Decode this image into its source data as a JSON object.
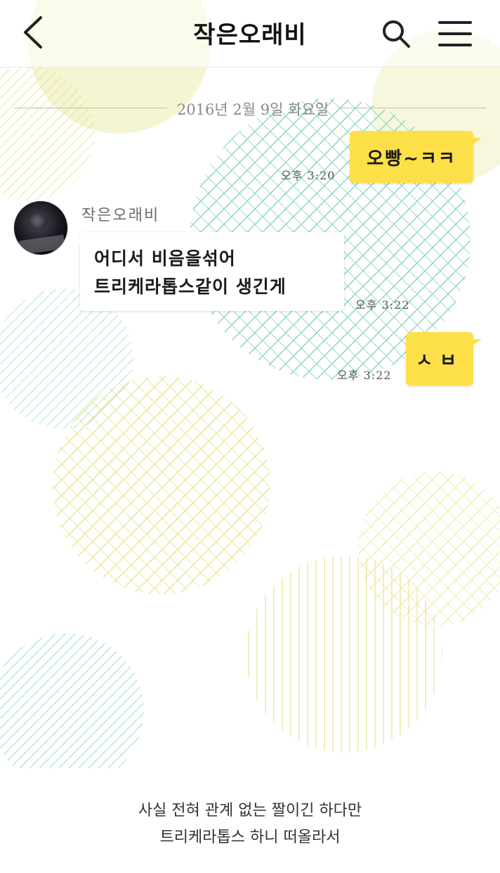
{
  "header": {
    "title": "작은오래비",
    "back_icon": "chevron-left-icon",
    "search_icon": "search-icon",
    "menu_icon": "hamburger-menu-icon"
  },
  "chat": {
    "date_divider": "2016년 2월 9일 화요일",
    "messages": [
      {
        "from": "me",
        "text": "오빵~ㅋㅋ",
        "time": "오후 3:20"
      },
      {
        "from": "them",
        "sender": "작은오래비",
        "lines": [
          "어디서 비음을섞어",
          "트리케라톱스같이 생긴게"
        ],
        "time": "오후 3:22"
      },
      {
        "from": "me",
        "text": "ㅅㅂ",
        "time": "오후 3:22"
      }
    ]
  },
  "caption": {
    "line1": "사실 전혀 관계 없는 짤이긴 하다만",
    "line2": "트리케라톱스 하니 떠올라서"
  },
  "colors": {
    "my_bubble": "#fde047",
    "pattern_green": "#7fd0c0",
    "pattern_yellow": "#e8e58a"
  }
}
